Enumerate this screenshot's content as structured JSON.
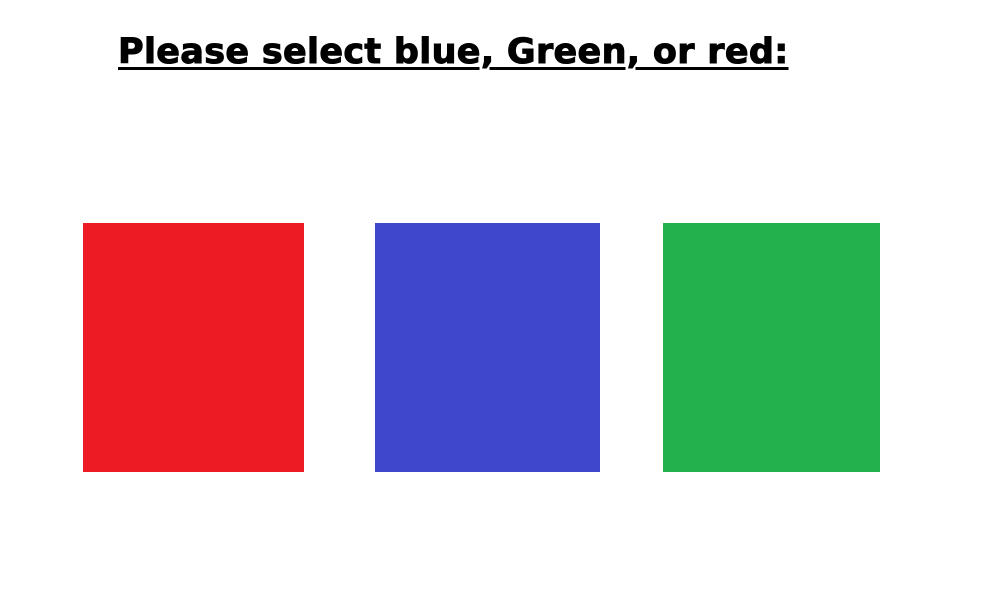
{
  "prompt": {
    "text": "Please select blue, Green, or red:"
  },
  "swatches": [
    {
      "name": "red",
      "color": "#ED1C24"
    },
    {
      "name": "blue",
      "color": "#3F48CC"
    },
    {
      "name": "green",
      "color": "#22B14C"
    }
  ]
}
